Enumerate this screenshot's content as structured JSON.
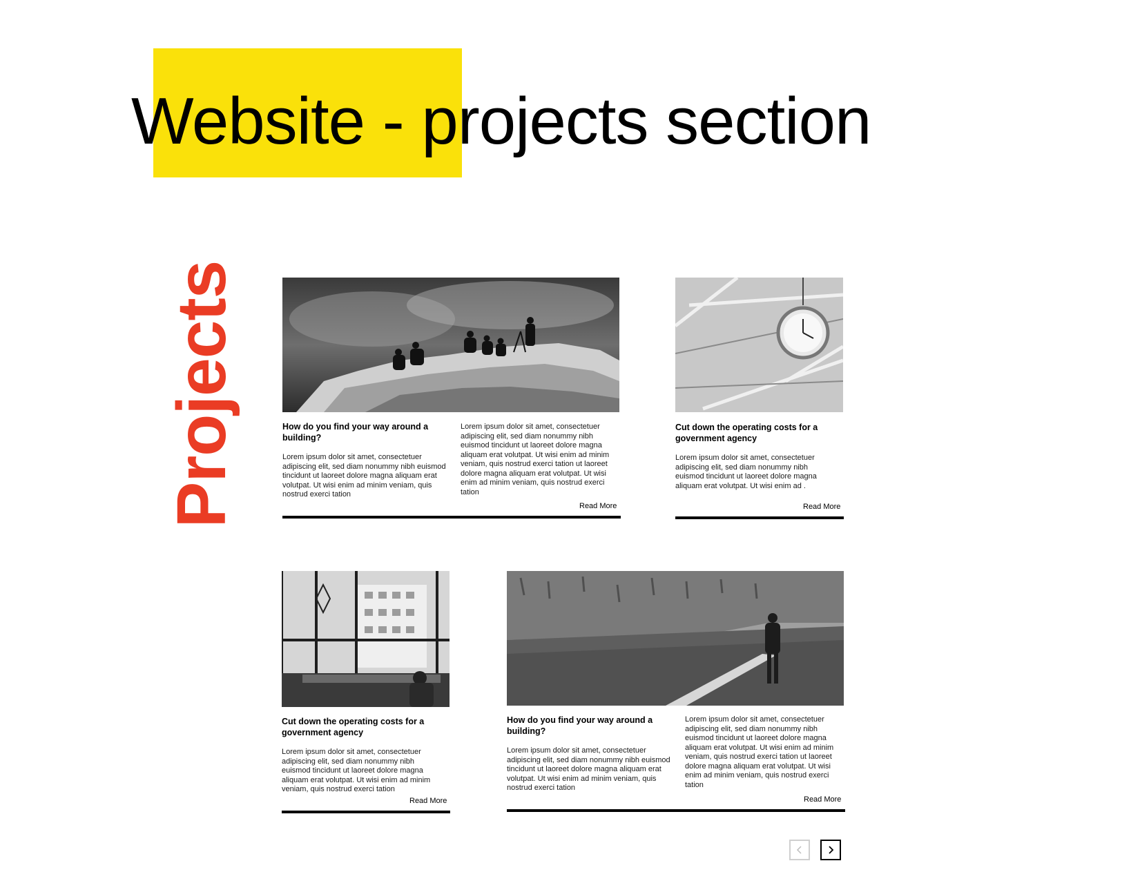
{
  "page": {
    "title": "Website - projects section",
    "highlight_color": "#fae10a"
  },
  "section": {
    "label": "Projects",
    "accent_color": "#ea3c24"
  },
  "cards": [
    {
      "image": "hikers-on-rocky-summit-photo",
      "title": "How do you find your way around a building?",
      "text_col1": "Lorem ipsum dolor sit amet, consectetuer adipiscing elit, sed diam nonummy nibh euismod tincidunt ut laoreet dolore magna aliquam erat volutpat. Ut wisi enim ad minim veniam, quis nostrud exerci tation",
      "text_col2": "Lorem ipsum dolor sit amet, consectetuer adipiscing elit, sed diam nonummy nibh euismod tincidunt ut laoreet dolore magna aliquam erat volutpat. Ut wisi enim ad minim veniam, quis nostrud exerci tation ut laoreet dolore magna aliquam erat volutpat. Ut wisi enim ad minim veniam, quis nostrud exerci tation",
      "read_more": "Read More"
    },
    {
      "image": "station-clock-ceiling-photo",
      "title": "Cut down the operating costs for a government agency",
      "text": "Lorem ipsum dolor sit amet, consectetuer adipiscing elit, sed diam nonummy nibh euismod tincidunt ut laoreet dolore magna aliquam erat volutpat. Ut wisi enim ad .",
      "read_more": "Read More"
    },
    {
      "image": "office-window-view-photo",
      "title": "Cut down the operating costs for a government agency",
      "text": "Lorem ipsum dolor sit amet, consectetuer adipiscing elit, sed diam nonummy nibh euismod tincidunt ut laoreet dolore magna aliquam erat volutpat. Ut wisi enim ad minim veniam, quis nostrud exerci tation",
      "read_more": "Read More"
    },
    {
      "image": "woman-walking-by-wall-photo",
      "title": "How do you find your way around a building?",
      "text_col1": "Lorem ipsum dolor sit amet, consectetuer adipiscing elit, sed diam nonummy nibh euismod tincidunt ut laoreet dolore magna aliquam erat volutpat. Ut wisi enim ad minim veniam, quis nostrud exerci tation",
      "text_col2": "Lorem ipsum dolor sit amet, consectetuer adipiscing elit, sed diam nonummy nibh euismod tincidunt ut laoreet dolore magna aliquam erat volutpat. Ut wisi enim ad minim veniam, quis nostrud exerci tation ut laoreet dolore magna aliquam erat volutpat. Ut wisi enim ad minim veniam, quis nostrud exerci tation",
      "read_more": "Read More"
    }
  ],
  "pagination": {
    "prev_icon": "chevron-left-icon",
    "next_icon": "chevron-right-icon"
  }
}
